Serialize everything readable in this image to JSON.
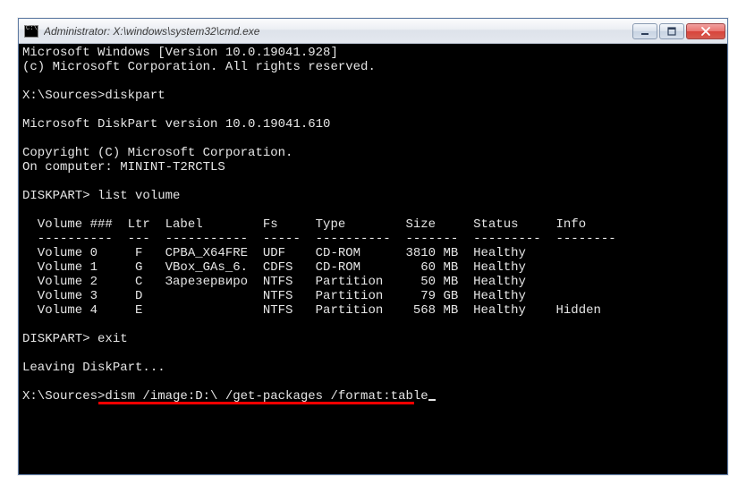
{
  "window": {
    "title": "Administrator: X:\\windows\\system32\\cmd.exe"
  },
  "terminal": {
    "lines": [
      "Microsoft Windows [Version 10.0.19041.928]",
      "(c) Microsoft Corporation. All rights reserved.",
      "",
      "X:\\Sources>diskpart",
      "",
      "Microsoft DiskPart version 10.0.19041.610",
      "",
      "Copyright (C) Microsoft Corporation.",
      "On computer: MININT-T2RCTLS",
      "",
      "DISKPART> list volume",
      "",
      "  Volume ###  Ltr  Label        Fs     Type        Size     Status     Info",
      "  ----------  ---  -----------  -----  ----------  -------  ---------  --------",
      "  Volume 0     F   CPBA_X64FRE  UDF    CD-ROM      3810 MB  Healthy",
      "  Volume 1     G   VBox_GAs_6.  CDFS   CD-ROM        60 MB  Healthy",
      "  Volume 2     C   Зарезервиро  NTFS   Partition     50 MB  Healthy",
      "  Volume 3     D                NTFS   Partition     79 GB  Healthy",
      "  Volume 4     E                NTFS   Partition    568 MB  Healthy    Hidden",
      "",
      "DISKPART> exit",
      "",
      "Leaving DiskPart...",
      "",
      "X:\\Sources>dism /image:D:\\ /get-packages /format:table"
    ],
    "last_prompt": "X:\\Sources>",
    "last_command": "dism /image:D:\\ /get-packages /format:table"
  },
  "chart_data": {
    "type": "table",
    "title": "list volume",
    "columns": [
      "Volume ###",
      "Ltr",
      "Label",
      "Fs",
      "Type",
      "Size",
      "Status",
      "Info"
    ],
    "rows": [
      [
        "Volume 0",
        "F",
        "CPBA_X64FRE",
        "UDF",
        "CD-ROM",
        "3810 MB",
        "Healthy",
        ""
      ],
      [
        "Volume 1",
        "G",
        "VBox_GAs_6.",
        "CDFS",
        "CD-ROM",
        "60 MB",
        "Healthy",
        ""
      ],
      [
        "Volume 2",
        "C",
        "Зарезервиро",
        "NTFS",
        "Partition",
        "50 MB",
        "Healthy",
        ""
      ],
      [
        "Volume 3",
        "D",
        "",
        "NTFS",
        "Partition",
        "79 GB",
        "Healthy",
        ""
      ],
      [
        "Volume 4",
        "E",
        "",
        "NTFS",
        "Partition",
        "568 MB",
        "Healthy",
        "Hidden"
      ]
    ]
  },
  "highlight": {
    "color": "#ff0000"
  }
}
